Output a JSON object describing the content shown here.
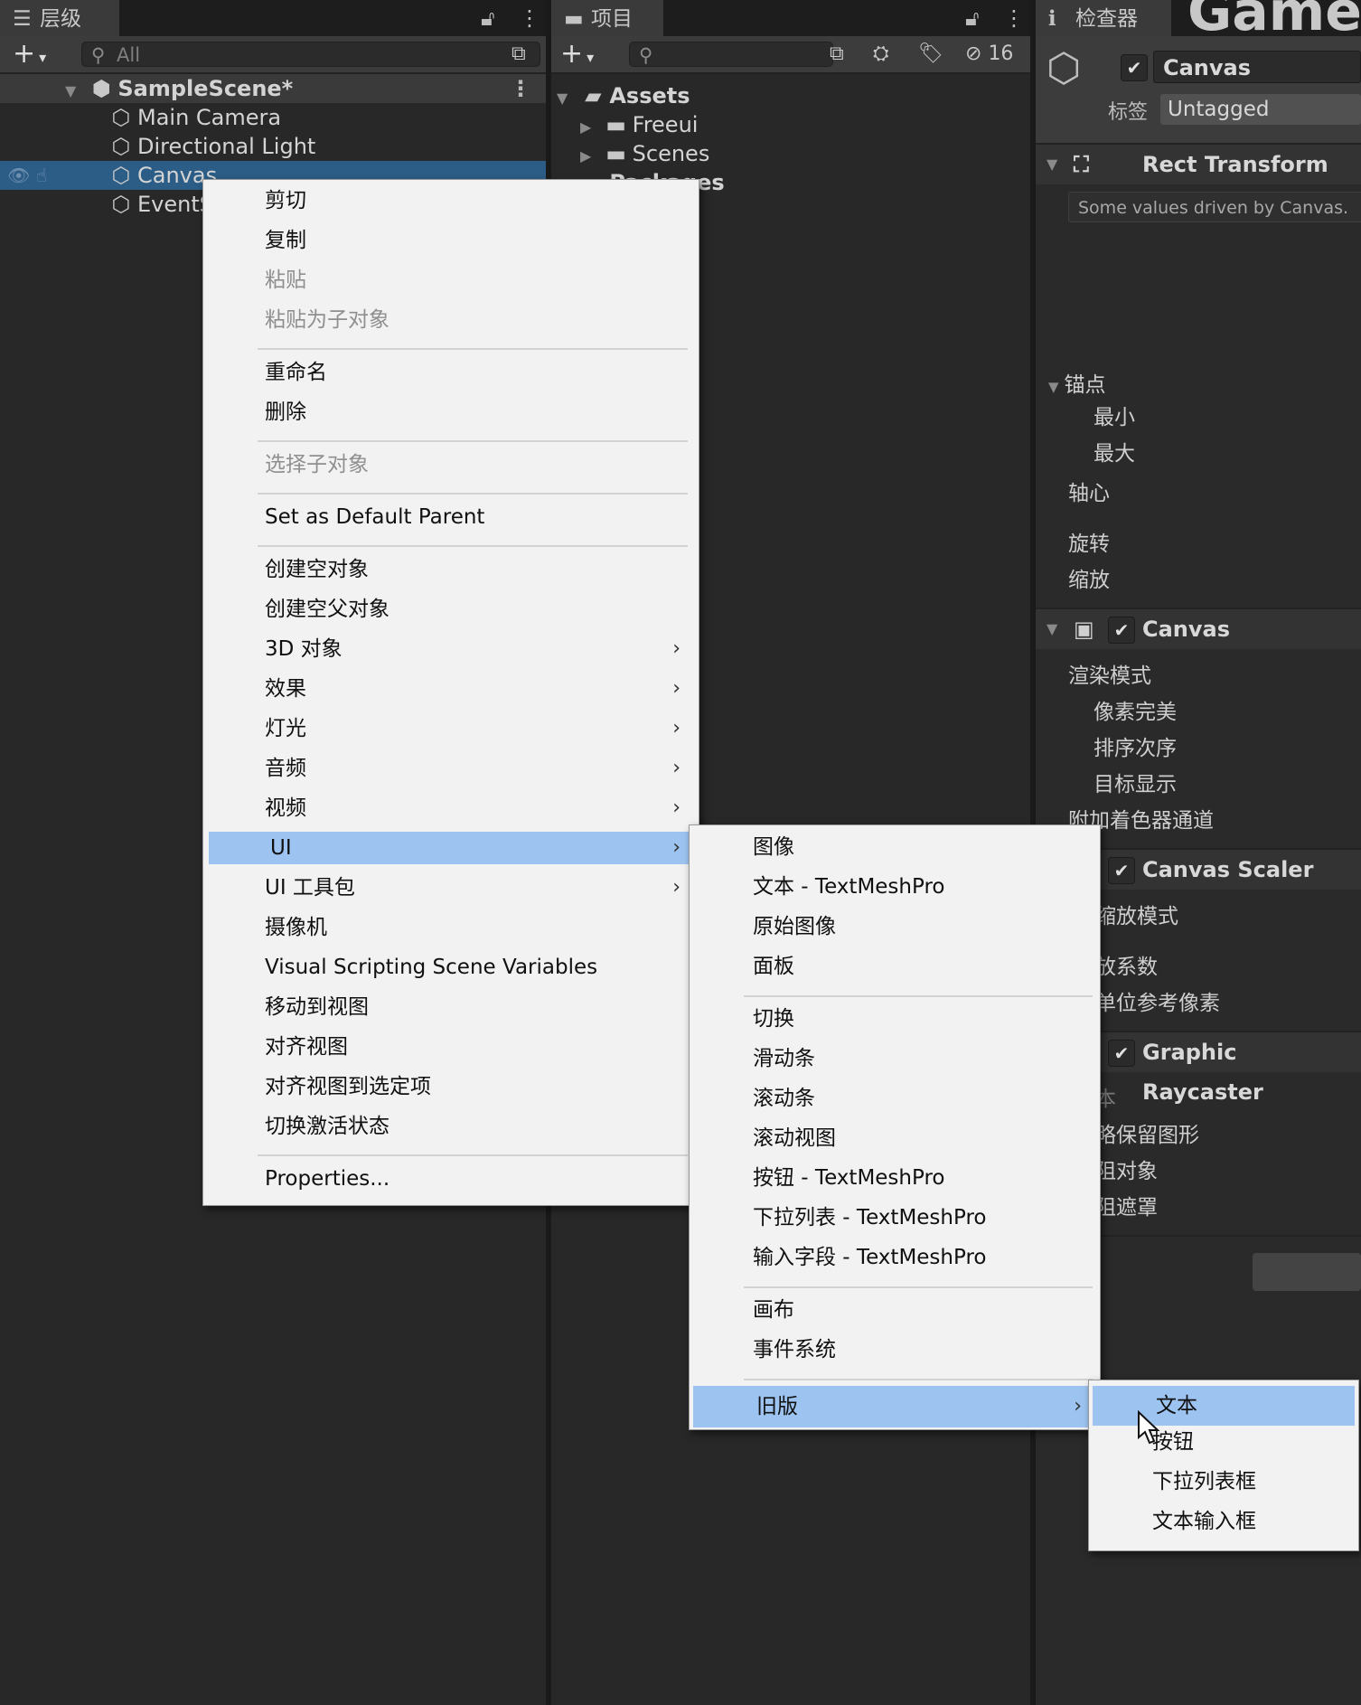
{
  "hierarchy": {
    "tab_label": "层级",
    "search_placeholder": "All",
    "scene_name": "SampleScene*",
    "items": [
      "Main Camera",
      "Directional Light",
      "Canvas",
      "EventSystem"
    ]
  },
  "project": {
    "tab_label": "项目",
    "hidden_count": "16",
    "tree": [
      "Assets",
      "Freeui",
      "Scenes",
      "Packages"
    ]
  },
  "inspector": {
    "tab_label": "检查器",
    "game_tab": "Game",
    "object_name": "Canvas",
    "tag_label": "标签",
    "tag_value": "Untagged",
    "rect_transform": {
      "title": "Rect Transform",
      "note": "Some values driven by Canvas.",
      "anchors": "锚点",
      "min": "最小",
      "max": "最大",
      "pivot": "轴心",
      "rotation": "旋转",
      "scale": "缩放"
    },
    "canvas": {
      "title": "Canvas",
      "render_mode": "渲染模式",
      "pixel_perfect": "像素完美",
      "sort_order": "排序次序",
      "target_display": "目标显示",
      "shader_channels": "附加着色器通道"
    },
    "canvas_scaler": {
      "title": "Canvas Scaler",
      "scale_mode": "缩放模式",
      "scale_factor": "放系数",
      "ref_pixels": "单位参考像素"
    },
    "graphic_raycaster": {
      "title": "Graphic Raycaster",
      "script": "本",
      "ignore_reversed": "略保留图形",
      "blocking_objects": "阻对象",
      "blocking_mask": "阻遮罩"
    }
  },
  "context_menu": {
    "items": [
      {
        "label": "剪切",
        "enabled": true
      },
      {
        "label": "复制",
        "enabled": true
      },
      {
        "label": "粘贴",
        "enabled": false
      },
      {
        "label": "粘贴为子对象",
        "enabled": false
      },
      {
        "label": "重命名",
        "enabled": true
      },
      {
        "label": "删除",
        "enabled": true
      },
      {
        "label": "选择子对象",
        "enabled": false
      },
      {
        "label": "Set as Default Parent",
        "enabled": true
      },
      {
        "label": "创建空对象",
        "enabled": true
      },
      {
        "label": "创建空父对象",
        "enabled": true
      },
      {
        "label": "3D 对象",
        "enabled": true
      },
      {
        "label": "效果",
        "enabled": true
      },
      {
        "label": "灯光",
        "enabled": true
      },
      {
        "label": "音频",
        "enabled": true
      },
      {
        "label": "视频",
        "enabled": true
      },
      {
        "label": "UI",
        "enabled": true
      },
      {
        "label": "UI 工具包",
        "enabled": true
      },
      {
        "label": "摄像机",
        "enabled": true
      },
      {
        "label": "Visual Scripting Scene Variables",
        "enabled": true
      },
      {
        "label": "移动到视图",
        "enabled": true
      },
      {
        "label": "对齐视图",
        "enabled": true
      },
      {
        "label": "对齐视图到选定项",
        "enabled": true
      },
      {
        "label": "切换激活状态",
        "enabled": true
      },
      {
        "label": "Properties...",
        "enabled": true
      }
    ]
  },
  "ui_submenu": {
    "items": [
      "图像",
      "文本 - TextMeshPro",
      "原始图像",
      "面板",
      "切换",
      "滑动条",
      "滚动条",
      "滚动视图",
      "按钮 - TextMeshPro",
      "下拉列表 - TextMeshPro",
      "输入字段 - TextMeshPro",
      "画布",
      "事件系统",
      "旧版"
    ]
  },
  "legacy_submenu": {
    "items": [
      "文本",
      "按钮",
      "下拉列表框",
      "文本输入框"
    ]
  },
  "colors": {
    "highlight": "#9dc4f1",
    "selection": "#2c5d87",
    "menu_bg": "#f2f2f2"
  }
}
